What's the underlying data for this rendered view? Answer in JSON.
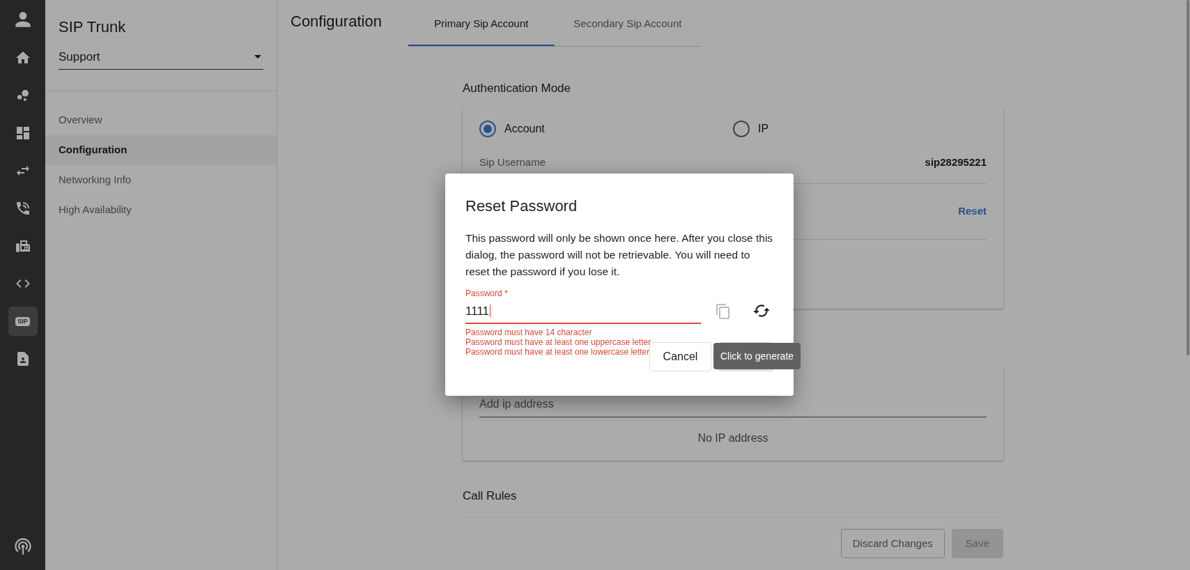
{
  "rail": {
    "items": [
      {
        "kind": "home",
        "selected": false
      },
      {
        "kind": "groups",
        "selected": false
      },
      {
        "kind": "dashboard",
        "selected": false
      },
      {
        "kind": "swap",
        "selected": false
      },
      {
        "kind": "phone",
        "selected": false
      },
      {
        "kind": "fax",
        "selected": false
      },
      {
        "kind": "code",
        "selected": false
      },
      {
        "kind": "sip",
        "label": "SIP",
        "selected": true
      },
      {
        "kind": "contact",
        "selected": false
      }
    ]
  },
  "sidebar": {
    "title": "SIP Trunk",
    "select": {
      "value": "Support"
    },
    "items": [
      {
        "label": "Overview",
        "selected": false
      },
      {
        "label": "Configuration",
        "selected": true
      },
      {
        "label": "Networking Info",
        "selected": false
      },
      {
        "label": "High Availability",
        "selected": false
      }
    ]
  },
  "main": {
    "title": "Configuration",
    "tabs": [
      {
        "label": "Primary Sip Account",
        "selected": true
      },
      {
        "label": "Secondary Sip Account",
        "selected": false
      }
    ],
    "auth_section": {
      "title": "Authentication Mode",
      "radios": [
        {
          "label": "Account",
          "selected": true
        },
        {
          "label": "IP",
          "selected": false
        }
      ],
      "username_label": "Sip Username",
      "username_value": "sip28295221",
      "reset_link": "Reset"
    },
    "ip_section": {
      "placeholder": "Add ip address",
      "empty_text": "No IP address"
    },
    "call_rules": {
      "title": "Call Rules"
    },
    "buttons": {
      "discard": "Discard Changes",
      "save": "Save"
    }
  },
  "dialog": {
    "title": "Reset Password",
    "message": "This password will only be shown once here. After you close this dialog, the password will not be retrievable. You will need to reset the password if you lose it.",
    "field": {
      "label": "Password *",
      "value": "1111",
      "error": true
    },
    "errors": [
      "Password must have 14 character",
      "Password must have at least one uppercase letter",
      "Password must have at least one lowercase letter"
    ],
    "tooltip": "Click to generate",
    "cancel": "Cancel",
    "reset_disabled": true
  }
}
